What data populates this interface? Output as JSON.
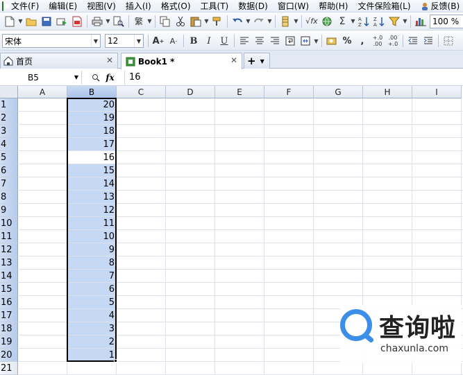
{
  "menubar": {
    "items": [
      "文件(F)",
      "编辑(E)",
      "视图(V)",
      "插入(I)",
      "格式(O)",
      "工具(T)",
      "数据(D)",
      "窗口(W)",
      "帮助(H)",
      "文件保险箱(L)",
      "反馈(B)"
    ]
  },
  "toolbar": {
    "font_name": "宋体",
    "font_size": "12",
    "zoom": "100 %"
  },
  "tabs": [
    {
      "label": "首页",
      "active": false
    },
    {
      "label": "Book1 *",
      "active": true
    }
  ],
  "formula_bar": {
    "cell_ref": "B5",
    "fx_label": "fx",
    "value": "16"
  },
  "sheet": {
    "columns": [
      "A",
      "B",
      "C",
      "D",
      "E",
      "F",
      "G",
      "H",
      "I"
    ],
    "selected_column": "B",
    "rows": [
      "1",
      "2",
      "3",
      "4",
      "5",
      "6",
      "7",
      "8",
      "9",
      "10",
      "11",
      "12",
      "13",
      "14",
      "15",
      "16",
      "17",
      "18",
      "19",
      "20",
      "21"
    ],
    "b_values": [
      "20",
      "19",
      "18",
      "17",
      "16",
      "15",
      "14",
      "13",
      "12",
      "11",
      "10",
      "9",
      "8",
      "7",
      "6",
      "5",
      "4",
      "3",
      "2",
      "1"
    ],
    "active_cell": "B5",
    "selection_color": "#c5d8f4"
  },
  "watermark": {
    "text_cn": "查询啦",
    "text_en": "chaxunla.com",
    "color": "#3c8fe8"
  }
}
